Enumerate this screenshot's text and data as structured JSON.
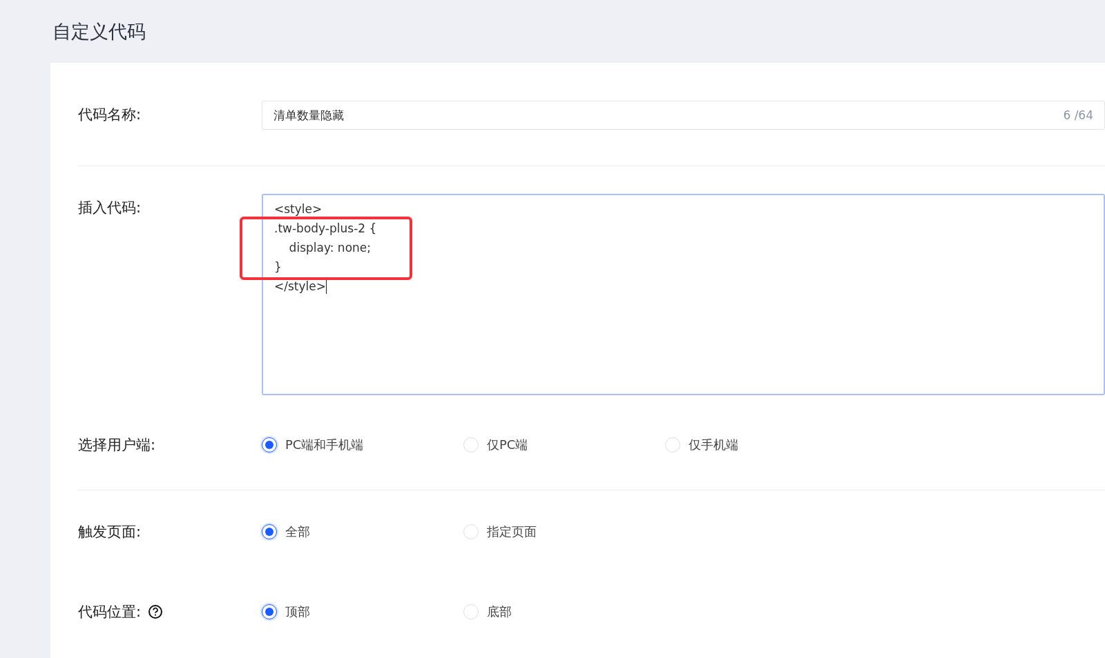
{
  "page": {
    "title": "自定义代码"
  },
  "code_name": {
    "label": "代码名称:",
    "value": "清单数量隐藏",
    "counter": "6 /64"
  },
  "insert_code": {
    "label": "插入代码:",
    "focused": true,
    "lines_before_box": [
      "<style>"
    ],
    "lines_in_red_box": [
      ".tw-body-plus-2 {",
      "    display: none;",
      "}"
    ],
    "lines_after_box": [
      "</style>"
    ]
  },
  "radio_groups": [
    {
      "label": "选择用户端:",
      "help": false,
      "divider_after": true,
      "options": [
        {
          "label": "PC端和手机端",
          "selected": true
        },
        {
          "label": "仅PC端",
          "selected": false
        },
        {
          "label": "仅手机端",
          "selected": false
        }
      ]
    },
    {
      "label": "触发页面:",
      "help": false,
      "divider_after": false,
      "options": [
        {
          "label": "全部",
          "selected": true
        },
        {
          "label": "指定页面",
          "selected": false
        }
      ]
    },
    {
      "label": "代码位置:",
      "help": true,
      "divider_after": false,
      "options": [
        {
          "label": "顶部",
          "selected": true
        },
        {
          "label": "底部",
          "selected": false
        }
      ]
    }
  ]
}
